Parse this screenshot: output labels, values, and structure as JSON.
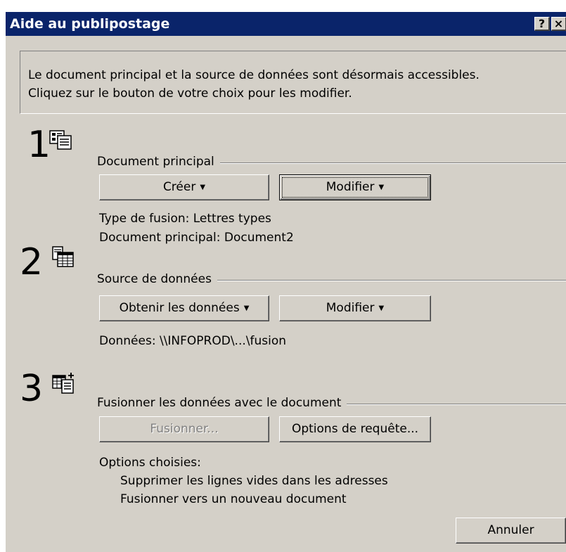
{
  "window": {
    "title": "Aide au publipostage",
    "help_btn": "?",
    "close_btn": "×"
  },
  "info": {
    "line1": "Le document principal et la source de données sont désormais accessibles.",
    "line2": "Cliquez sur le bouton de votre choix pour les modifier."
  },
  "step1": {
    "number": "1",
    "icon": "document-form-icon",
    "label": "Document principal",
    "create_button": "Créer",
    "modify_button": "Modifier",
    "merge_type": "Type de fusion: Lettres types",
    "main_document": "Document principal: Document2"
  },
  "step2": {
    "number": "2",
    "icon": "data-table-icon",
    "label": "Source de données",
    "get_data_button": "Obtenir les données",
    "modify_button": "Modifier",
    "data_path": "Données: \\\\INFOPROD\\...\\fusion"
  },
  "step3": {
    "number": "3",
    "icon": "merge-table-icon",
    "label": "Fusionner les données avec le document",
    "merge_button": "Fusionner...",
    "query_options_button": "Options de requête...",
    "options_title": "Options choisies:",
    "option1": "Supprimer les lignes vides dans les adresses",
    "option2": "Fusionner vers un nouveau document"
  },
  "footer": {
    "cancel_button": "Annuler"
  }
}
